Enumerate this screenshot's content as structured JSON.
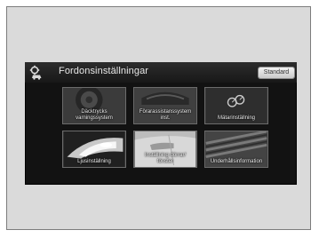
{
  "header": {
    "title": "Fordonsinställningar",
    "standard_button": "Standard"
  },
  "tiles": [
    {
      "label": "Däcktrycks varningssystem",
      "icon": "tire-icon"
    },
    {
      "label": "Förarassistanssystem inst.",
      "icon": "driver-assist-icon"
    },
    {
      "label": "Mätarinställning",
      "icon": "meter-icon"
    },
    {
      "label": "Ljusinställning",
      "icon": "headlight-icon"
    },
    {
      "label": "Inställning dörrar/ fönster",
      "icon": "door-icon"
    },
    {
      "label": "Underhållsinformation",
      "icon": "maintenance-icon"
    }
  ],
  "colors": {
    "screen_bg": "#121212",
    "title_text": "#e6e6e6",
    "tile_border": "#6c6c6c"
  }
}
